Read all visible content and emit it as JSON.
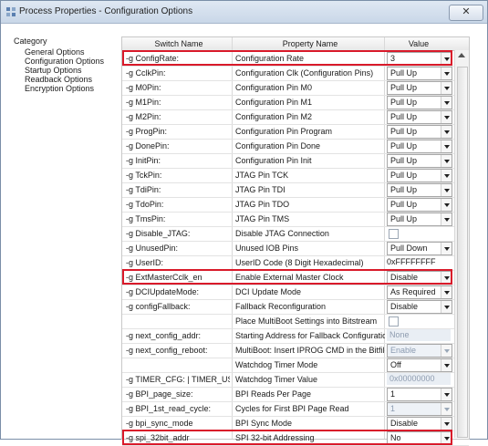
{
  "window": {
    "title": "Process Properties - Configuration Options",
    "close_glyph": "✕"
  },
  "category": {
    "title": "Category",
    "items": [
      "General Options",
      "Configuration Options",
      "Startup Options",
      "Readback Options",
      "Encryption Options"
    ]
  },
  "table": {
    "headers": [
      "Switch Name",
      "Property Name",
      "Value"
    ],
    "rows": [
      {
        "switch": "-g ConfigRate:",
        "property": "Configuration Rate",
        "value": "3",
        "kind": "select",
        "highlight": true
      },
      {
        "switch": "-g CclkPin:",
        "property": "Configuration Clk (Configuration Pins)",
        "value": "Pull Up",
        "kind": "select"
      },
      {
        "switch": "-g M0Pin:",
        "property": "Configuration Pin M0",
        "value": "Pull Up",
        "kind": "select"
      },
      {
        "switch": "-g M1Pin:",
        "property": "Configuration Pin M1",
        "value": "Pull Up",
        "kind": "select"
      },
      {
        "switch": "-g M2Pin:",
        "property": "Configuration Pin M2",
        "value": "Pull Up",
        "kind": "select"
      },
      {
        "switch": "-g ProgPin:",
        "property": "Configuration Pin Program",
        "value": "Pull Up",
        "kind": "select"
      },
      {
        "switch": "-g DonePin:",
        "property": "Configuration Pin Done",
        "value": "Pull Up",
        "kind": "select"
      },
      {
        "switch": "-g InitPin:",
        "property": "Configuration Pin Init",
        "value": "Pull Up",
        "kind": "select"
      },
      {
        "switch": "-g TckPin:",
        "property": "JTAG Pin TCK",
        "value": "Pull Up",
        "kind": "select"
      },
      {
        "switch": "-g TdiPin:",
        "property": "JTAG Pin TDI",
        "value": "Pull Up",
        "kind": "select"
      },
      {
        "switch": "-g TdoPin:",
        "property": "JTAG Pin TDO",
        "value": "Pull Up",
        "kind": "select"
      },
      {
        "switch": "-g TmsPin:",
        "property": "JTAG Pin TMS",
        "value": "Pull Up",
        "kind": "select"
      },
      {
        "switch": "-g Disable_JTAG:",
        "property": "Disable JTAG Connection",
        "value": "",
        "kind": "check"
      },
      {
        "switch": "-g UnusedPin:",
        "property": "Unused IOB Pins",
        "value": "Pull Down",
        "kind": "select"
      },
      {
        "switch": "-g UserID:",
        "property": "UserID Code (8 Digit Hexadecimal)",
        "value": "0xFFFFFFFF",
        "kind": "text"
      },
      {
        "switch": "-g ExtMasterCclk_en",
        "property": "Enable External Master Clock",
        "value": "Disable",
        "kind": "select",
        "highlight": true
      },
      {
        "switch": "-g DCIUpdateMode:",
        "property": "DCI Update Mode",
        "value": "As Required",
        "kind": "select"
      },
      {
        "switch": "-g configFallback:",
        "property": "Fallback Reconfiguration",
        "value": "Disable",
        "kind": "select"
      },
      {
        "switch": "",
        "property": "Place MultiBoot Settings into Bitstream",
        "value": "",
        "kind": "check"
      },
      {
        "switch": "-g next_config_addr:",
        "property": "Starting Address for Fallback Configuration",
        "value": "None",
        "kind": "text-disabled"
      },
      {
        "switch": "-g next_config_reboot:",
        "property": "MultiBoot: Insert IPROG CMD in the Bitfile",
        "value": "Enable",
        "kind": "select-disabled"
      },
      {
        "switch": "",
        "property": "Watchdog Timer Mode",
        "value": "Off",
        "kind": "select"
      },
      {
        "switch": "-g TIMER_CFG: | TIMER_USR:",
        "property": "Watchdog Timer Value",
        "value": "0x00000000",
        "kind": "text-disabled"
      },
      {
        "switch": "-g BPI_page_size:",
        "property": "BPI Reads Per Page",
        "value": "1",
        "kind": "select"
      },
      {
        "switch": "-g BPI_1st_read_cycle:",
        "property": "Cycles for First BPI Page Read",
        "value": "1",
        "kind": "select-disabled"
      },
      {
        "switch": "-g bpi_sync_mode",
        "property": "BPI Sync Mode",
        "value": "Disable",
        "kind": "select"
      },
      {
        "switch": "-g spi_32bit_addr",
        "property": "SPI 32-bit Addressing",
        "value": "No",
        "kind": "select",
        "highlight": true
      }
    ]
  },
  "colors": {
    "highlight": "#d91a2a",
    "accent": "#7a8ea8"
  }
}
